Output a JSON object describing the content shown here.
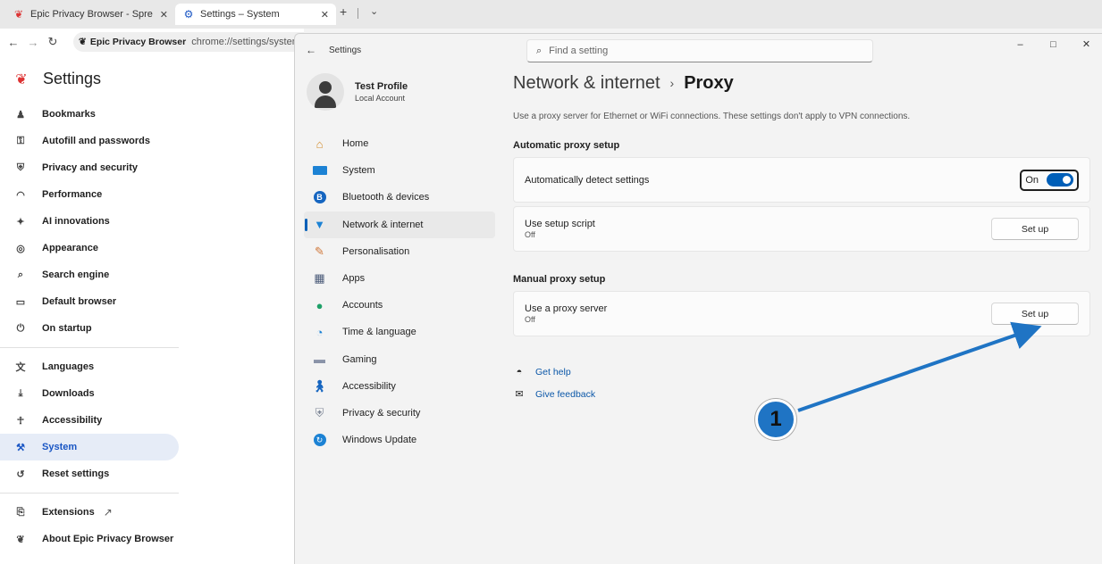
{
  "browser": {
    "tabs": [
      {
        "title": "Epic Privacy Browser - Spread E",
        "close": "✕"
      },
      {
        "title": "Settings – System",
        "close": "✕"
      }
    ],
    "new_tab": "+",
    "tab_menu": "⌄",
    "omnibox": {
      "chip": "Epic Privacy Browser",
      "url": "chrome://settings/system"
    }
  },
  "chrome_settings": {
    "title": "Settings",
    "nav": [
      {
        "label": "Bookmarks",
        "icon": "person-icon"
      },
      {
        "label": "Autofill and passwords",
        "icon": "key-icon"
      },
      {
        "label": "Privacy and security",
        "icon": "shield-icon"
      },
      {
        "label": "Performance",
        "icon": "gauge-icon"
      },
      {
        "label": "AI innovations",
        "icon": "sparkle-icon"
      },
      {
        "label": "Appearance",
        "icon": "palette-icon"
      },
      {
        "label": "Search engine",
        "icon": "search-icon"
      },
      {
        "label": "Default browser",
        "icon": "browser-icon"
      },
      {
        "label": "On startup",
        "icon": "power-icon"
      }
    ],
    "nav2": [
      {
        "label": "Languages",
        "icon": "translate-icon"
      },
      {
        "label": "Downloads",
        "icon": "download-icon"
      },
      {
        "label": "Accessibility",
        "icon": "accessibility-icon"
      },
      {
        "label": "System",
        "icon": "wrench-icon",
        "active": true
      },
      {
        "label": "Reset settings",
        "icon": "reset-icon"
      }
    ],
    "nav3": [
      {
        "label": "Extensions",
        "icon": "puzzle-icon"
      },
      {
        "label": "About Epic Privacy Browser",
        "icon": "epic-logo-icon"
      }
    ]
  },
  "windows_settings": {
    "title": "Settings",
    "search_placeholder": "Find a setting",
    "profile": {
      "name": "Test Profile",
      "type": "Local Account"
    },
    "nav": [
      {
        "label": "Home",
        "icon": "home-icon"
      },
      {
        "label": "System",
        "icon": "monitor-icon"
      },
      {
        "label": "Bluetooth & devices",
        "icon": "bluetooth-icon"
      },
      {
        "label": "Network & internet",
        "icon": "wifi-icon",
        "active": true
      },
      {
        "label": "Personalisation",
        "icon": "brush-icon"
      },
      {
        "label": "Apps",
        "icon": "apps-icon"
      },
      {
        "label": "Accounts",
        "icon": "account-icon"
      },
      {
        "label": "Time & language",
        "icon": "globe-clock-icon"
      },
      {
        "label": "Gaming",
        "icon": "gamepad-icon"
      },
      {
        "label": "Accessibility",
        "icon": "accessibility-icon"
      },
      {
        "label": "Privacy & security",
        "icon": "shield-icon"
      },
      {
        "label": "Windows Update",
        "icon": "update-icon"
      }
    ],
    "breadcrumb": {
      "parent": "Network & internet",
      "separator": "›",
      "current": "Proxy"
    },
    "description": "Use a proxy server for Ethernet or WiFi connections. These settings don't apply to VPN connections.",
    "auto_section": {
      "heading": "Automatic proxy setup",
      "detect": {
        "label": "Automatically detect settings",
        "toggle_label": "On",
        "toggle_on": true
      },
      "script": {
        "label": "Use setup script",
        "status": "Off",
        "button": "Set up"
      }
    },
    "manual_section": {
      "heading": "Manual proxy setup",
      "proxy": {
        "label": "Use a proxy server",
        "status": "Off",
        "button": "Set up"
      }
    },
    "help": [
      {
        "label": "Get help",
        "icon": "help-icon"
      },
      {
        "label": "Give feedback",
        "icon": "feedback-icon"
      }
    ]
  },
  "annotation": {
    "number": "1",
    "color": "#1f74c4"
  }
}
